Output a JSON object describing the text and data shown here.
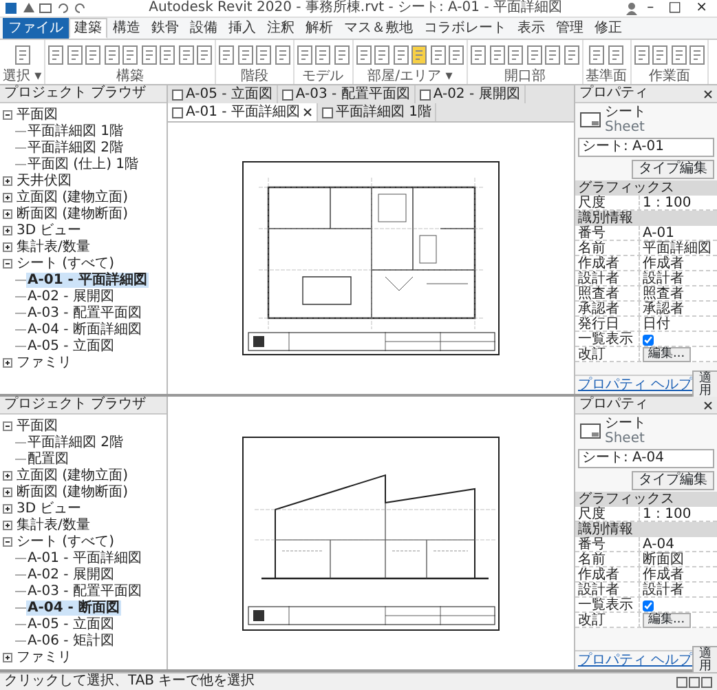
{
  "title_bar": {
    "title": "Autodesk Revit 2020 - 事務所棟.rvt - シート: A-01 - 平面詳細図",
    "window_controls": [
      "–",
      "□",
      "×"
    ]
  },
  "ribbon": {
    "tabs": [
      {
        "label": "ファイル",
        "kind": "file",
        "selected": false
      },
      {
        "label": "建築",
        "kind": "tab",
        "selected": true
      },
      {
        "label": "構造",
        "kind": "tab",
        "selected": false
      },
      {
        "label": "鉄骨",
        "kind": "tab",
        "selected": false
      },
      {
        "label": "設備",
        "kind": "tab",
        "selected": false
      },
      {
        "label": "挿入",
        "kind": "tab",
        "selected": false
      },
      {
        "label": "注釈",
        "kind": "tab",
        "selected": false
      },
      {
        "label": "解析",
        "kind": "tab",
        "selected": false
      },
      {
        "label": "マス＆敷地",
        "kind": "tab",
        "selected": false
      },
      {
        "label": "コラボレート",
        "kind": "tab",
        "selected": false
      },
      {
        "label": "表示",
        "kind": "tab",
        "selected": false
      },
      {
        "label": "管理",
        "kind": "tab",
        "selected": false
      },
      {
        "label": "修正",
        "kind": "tab",
        "selected": false
      }
    ],
    "panels": [
      {
        "title": "選択 ▾",
        "tools": [
          {
            "selected": false
          }
        ]
      },
      {
        "title": "構築",
        "tools": [
          {
            "selected": false
          },
          {
            "selected": false
          },
          {
            "selected": false
          },
          {
            "selected": false
          },
          {
            "selected": false
          },
          {
            "selected": false
          },
          {
            "selected": false
          },
          {
            "selected": false
          },
          {
            "selected": false
          }
        ]
      },
      {
        "title": "階段",
        "tools": [
          {
            "selected": false
          },
          {
            "selected": false
          },
          {
            "selected": false
          },
          {
            "selected": false
          }
        ]
      },
      {
        "title": "モデル",
        "tools": [
          {
            "selected": false
          },
          {
            "selected": false
          },
          {
            "selected": false
          }
        ]
      },
      {
        "title": "部屋/エリア ▾",
        "tools": [
          {
            "selected": false
          },
          {
            "selected": false
          },
          {
            "selected": false
          },
          {
            "selected": true
          },
          {
            "selected": false
          },
          {
            "selected": false
          }
        ]
      },
      {
        "title": "開口部",
        "tools": [
          {
            "selected": false
          },
          {
            "selected": false
          },
          {
            "selected": false
          },
          {
            "selected": false
          },
          {
            "selected": false
          },
          {
            "selected": false
          }
        ]
      },
      {
        "title": "基準面",
        "tools": [
          {
            "selected": false
          },
          {
            "selected": false
          }
        ]
      },
      {
        "title": "作業面",
        "tools": [
          {
            "selected": false
          },
          {
            "selected": false
          },
          {
            "selected": false
          },
          {
            "selected": false
          }
        ]
      }
    ]
  },
  "panes": [
    {
      "browser": {
        "title": "プロジェクト ブラウザ",
        "tree": [
          {
            "label": "平面図",
            "expanded": true,
            "selected": false,
            "children": [
              {
                "label": "平面詳細図 1階",
                "selected": false
              },
              {
                "label": "平面詳細図 2階",
                "selected": false
              },
              {
                "label": "平面図 (仕上) 1階",
                "selected": false
              }
            ]
          },
          {
            "label": "天井伏図",
            "expanded": false,
            "selected": false
          },
          {
            "label": "立面図 (建物立面)",
            "expanded": false,
            "selected": false
          },
          {
            "label": "断面図 (建物断面)",
            "expanded": false,
            "selected": false
          },
          {
            "label": "3D ビュー",
            "expanded": false,
            "selected": false
          },
          {
            "label": "集計表/数量",
            "expanded": false,
            "selected": false
          },
          {
            "label": "シート (すべて)",
            "expanded": true,
            "selected": false,
            "children": [
              {
                "label": "A-01 - 平面詳細図",
                "selected": true
              },
              {
                "label": "A-02 - 展開図",
                "selected": false
              },
              {
                "label": "A-03 - 配置平面図",
                "selected": false
              },
              {
                "label": "A-04 - 断面詳細図",
                "selected": false
              },
              {
                "label": "A-05 - 立面図",
                "selected": false
              }
            ]
          },
          {
            "label": "ファミリ",
            "expanded": false,
            "selected": false
          }
        ]
      },
      "view": {
        "kind": "plan",
        "tabs": [
          {
            "label": "A-05 - 立面図",
            "selected": false
          },
          {
            "label": "A-03 - 配置平面図",
            "selected": false
          },
          {
            "label": "A-02 - 展開図",
            "selected": false
          },
          {
            "label": "A-01 - 平面詳細図",
            "selected": true
          },
          {
            "label": "平面詳細図 1階",
            "selected": false
          }
        ]
      },
      "properties": {
        "title": "プロパティ",
        "type_name": "シート",
        "type_sub": "Sheet",
        "selector": "シート: A-01",
        "edit_type": "タイプ編集",
        "groups": [
          {
            "title": "グラフィックス",
            "rows": [
              {
                "kind": "text",
                "label": "尺度",
                "value": "1 : 100"
              }
            ]
          },
          {
            "title": "識別情報",
            "rows": [
              {
                "kind": "text",
                "label": "番号",
                "value": "A-01"
              },
              {
                "kind": "text",
                "label": "名前",
                "value": "平面詳細図"
              },
              {
                "kind": "text",
                "label": "作成者",
                "value": "作成者"
              },
              {
                "kind": "text",
                "label": "設計者",
                "value": "設計者"
              },
              {
                "kind": "text",
                "label": "照査者",
                "value": "照査者"
              },
              {
                "kind": "text",
                "label": "承認者",
                "value": "承認者"
              },
              {
                "kind": "text",
                "label": "発行日",
                "value": "日付"
              },
              {
                "kind": "checkbox",
                "label": "一覧表示",
                "checked": true
              },
              {
                "kind": "button",
                "label": "改訂",
                "value": "編集..."
              }
            ]
          }
        ],
        "help": "プロパティ ヘルプ",
        "apply": "適用"
      }
    },
    {
      "browser": {
        "title": "プロジェクト ブラウザ",
        "tree": [
          {
            "label": "平面図",
            "expanded": true,
            "selected": false,
            "children": [
              {
                "label": "平面詳細図 2階",
                "selected": false
              },
              {
                "label": "配置図",
                "selected": false
              }
            ]
          },
          {
            "label": "立面図 (建物立面)",
            "expanded": false,
            "selected": false
          },
          {
            "label": "断面図 (建物断面)",
            "expanded": false,
            "selected": false
          },
          {
            "label": "3D ビュー",
            "expanded": false,
            "selected": false
          },
          {
            "label": "集計表/数量",
            "expanded": false,
            "selected": false
          },
          {
            "label": "シート (すべて)",
            "expanded": true,
            "selected": false,
            "children": [
              {
                "label": "A-01 - 平面詳細図",
                "selected": false
              },
              {
                "label": "A-02 - 展開図",
                "selected": false
              },
              {
                "label": "A-03 - 配置平面図",
                "selected": false
              },
              {
                "label": "A-04 - 断面図",
                "selected": true
              },
              {
                "label": "A-05 - 立面図",
                "selected": false
              },
              {
                "label": "A-06 - 矩計図",
                "selected": false
              }
            ]
          },
          {
            "label": "ファミリ",
            "expanded": false,
            "selected": false
          }
        ]
      },
      "view": {
        "kind": "section"
      },
      "properties": {
        "title": "プロパティ",
        "type_name": "シート",
        "type_sub": "Sheet",
        "selector": "シート: A-04",
        "edit_type": "タイプ編集",
        "groups": [
          {
            "title": "グラフィックス",
            "rows": [
              {
                "kind": "text",
                "label": "尺度",
                "value": "1 : 100"
              }
            ]
          },
          {
            "title": "識別情報",
            "rows": [
              {
                "kind": "text",
                "label": "番号",
                "value": "A-04"
              },
              {
                "kind": "text",
                "label": "名前",
                "value": "断面図"
              },
              {
                "kind": "text",
                "label": "作成者",
                "value": "作成者"
              },
              {
                "kind": "text",
                "label": "設計者",
                "value": "設計者"
              },
              {
                "kind": "checkbox",
                "label": "一覧表示",
                "checked": true
              },
              {
                "kind": "button",
                "label": "改訂",
                "value": "編集..."
              }
            ]
          }
        ],
        "help": "プロパティ ヘルプ",
        "apply": "適用"
      }
    }
  ],
  "status_bar": {
    "text": "クリックして選択、TAB キーで他を選択"
  }
}
